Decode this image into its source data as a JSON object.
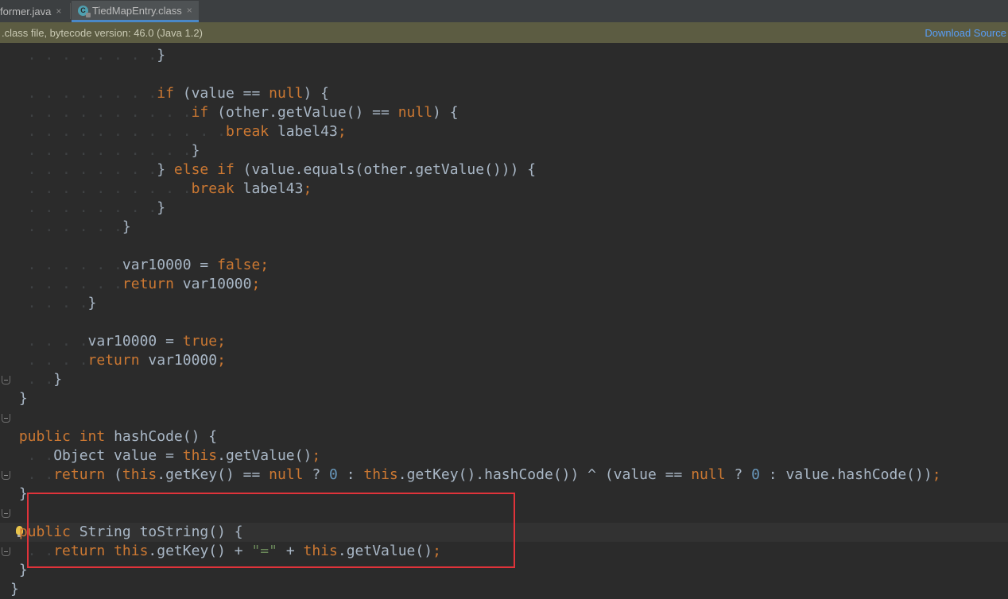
{
  "tabs": [
    {
      "label": "former.java",
      "close": "×",
      "active": false
    },
    {
      "label": "TiedMapEntry.class",
      "close": "×",
      "active": true
    }
  ],
  "infobar": {
    "message": ".class file, bytecode version: 46.0 (Java 1.2)",
    "action": "Download Source"
  },
  "colors": {
    "keyword": "#cc7832",
    "number": "#6897bb",
    "string": "#6a8759",
    "text": "#a9b7c6",
    "background": "#2b2b2b",
    "highlight_box": "#e0333a"
  },
  "code_lines": [
    "                 }",
    "",
    "                 if (value == null) {",
    "                     if (other.getValue() == null) {",
    "                         break label43;",
    "                     }",
    "                 } else if (value.equals(other.getValue())) {",
    "                     break label43;",
    "                 }",
    "             }",
    "",
    "             var10000 = false;",
    "             return var10000;",
    "         }",
    "",
    "         var10000 = true;",
    "         return var10000;",
    "     }",
    " }",
    "",
    " public int hashCode() {",
    "     Object value = this.getValue();",
    "     return (this.getKey() == null ? 0 : this.getKey().hashCode()) ^ (value == null ? 0 : value.hashCode());",
    " }",
    "",
    " public String toString() {",
    "     return this.getKey() + \"=\" + this.getValue();",
    " }",
    "}"
  ]
}
